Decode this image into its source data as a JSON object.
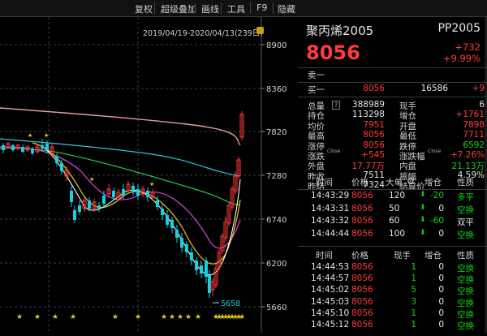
{
  "toolbar": {
    "items": [
      "复权",
      "超级叠加",
      "画线",
      "工具",
      "F9",
      "隐藏"
    ]
  },
  "chart": {
    "date_range": "2019/04/19-2020/04/13(239日)",
    "price_ticks": [
      "8900",
      "8360",
      "7820",
      "7280",
      "6740",
      "6200",
      "5660"
    ],
    "low_marker": "5658",
    "colors": {
      "up": "#ff3b3b",
      "down": "#19d0e0",
      "ma5": "#ffffff",
      "ma10": "#e5c820",
      "ma20": "#e040e0",
      "ma60": "#2ec845",
      "ma120": "#ffffff",
      "ma250": "#e89a9a",
      "ma_long": "#27c8e0",
      "star": "#e5c820"
    }
  },
  "quote": {
    "name": "聚丙烯2005",
    "code": "PP2005",
    "price": "8056",
    "change": "+732",
    "change_pct": "+9.99%",
    "sell1": {
      "label": "卖一",
      "price": "",
      "vol": ""
    },
    "buy1": {
      "label": "买一",
      "price": "8056",
      "vol": "16586",
      "delta": "+9"
    },
    "stats": [
      {
        "l1": "总量",
        "info": "?",
        "v1": "388989",
        "c1": "white",
        "l2": "现手",
        "v2": "6",
        "c2": "white"
      },
      {
        "l1": "持仓",
        "v1": "113298",
        "c1": "white",
        "l2": "增仓",
        "v2": "+1761",
        "c2": "red"
      },
      {
        "l1": "均价",
        "v1": "7951",
        "c1": "red",
        "l2": "开盘",
        "v2": "7898",
        "c2": "red"
      },
      {
        "l1": "最高",
        "v1": "8056",
        "c1": "red",
        "l2": "最低",
        "v2": "7711",
        "c2": "red"
      },
      {
        "l1": "涨停",
        "v1": "8056",
        "c1": "red",
        "l2": "跌停",
        "v2": "6592",
        "c2": "green"
      },
      {
        "l1": "涨跌",
        "sup1": "Close",
        "v1": "+545",
        "c1": "red",
        "l2": "涨跌幅",
        "sup2": "Close",
        "v2": "+7.26%",
        "c2": "red"
      },
      {
        "l1": "外盘",
        "v1": "17.77万",
        "c1": "red",
        "l2": "内盘",
        "v2": "21.13万",
        "c2": "green"
      },
      {
        "l1": "昨收",
        "v1": "7511",
        "c1": "white",
        "l2": "振幅",
        "v2": "4.59%",
        "c2": "white"
      },
      {
        "l1": "昨结",
        "v1": "7324",
        "c1": "white",
        "l2": "结算价",
        "v2": "",
        "c2": "white"
      }
    ],
    "ticks_header": [
      "时间",
      "价格",
      "大单",
      "增仓",
      "性质"
    ],
    "ticks": [
      {
        "time": "14:43:29",
        "price": "8056",
        "vol": "120",
        "arrow": "down",
        "pos": "-20",
        "pos_color": "green",
        "nature": "多平",
        "nature_color": "green"
      },
      {
        "time": "14:43:31",
        "price": "8056",
        "vol": "50",
        "arrow": "down",
        "pos": "0",
        "pos_color": "white",
        "nature": "空换",
        "nature_color": "green"
      },
      {
        "time": "14:43:32",
        "price": "8056",
        "vol": "60",
        "arrow": "down",
        "pos": "-60",
        "pos_color": "green",
        "nature": "双平",
        "nature_color": "white"
      },
      {
        "time": "14:44:44",
        "price": "8056",
        "vol": "100",
        "arrow": "down",
        "pos": "0",
        "pos_color": "white",
        "nature": "空换",
        "nature_color": "green"
      }
    ],
    "trades_header": [
      "时间",
      "价格",
      "现手",
      "增仓",
      "性质"
    ],
    "trades": [
      {
        "time": "14:44:53",
        "price": "8056",
        "vol": "1",
        "pos": "0",
        "nature": "空换"
      },
      {
        "time": "14:44:57",
        "price": "8056",
        "vol": "1",
        "pos": "0",
        "nature": "空换"
      },
      {
        "time": "14:45:02",
        "price": "8056",
        "vol": "5",
        "pos": "0",
        "nature": "空换"
      },
      {
        "time": "14:45:03",
        "price": "8056",
        "vol": "3",
        "pos": "0",
        "nature": "空换"
      },
      {
        "time": "14:45:10",
        "price": "8056",
        "vol": "1",
        "pos": "0",
        "nature": "空换"
      },
      {
        "time": "14:45:12",
        "price": "8056",
        "vol": "1",
        "pos": "0",
        "nature": "空换"
      }
    ]
  }
}
